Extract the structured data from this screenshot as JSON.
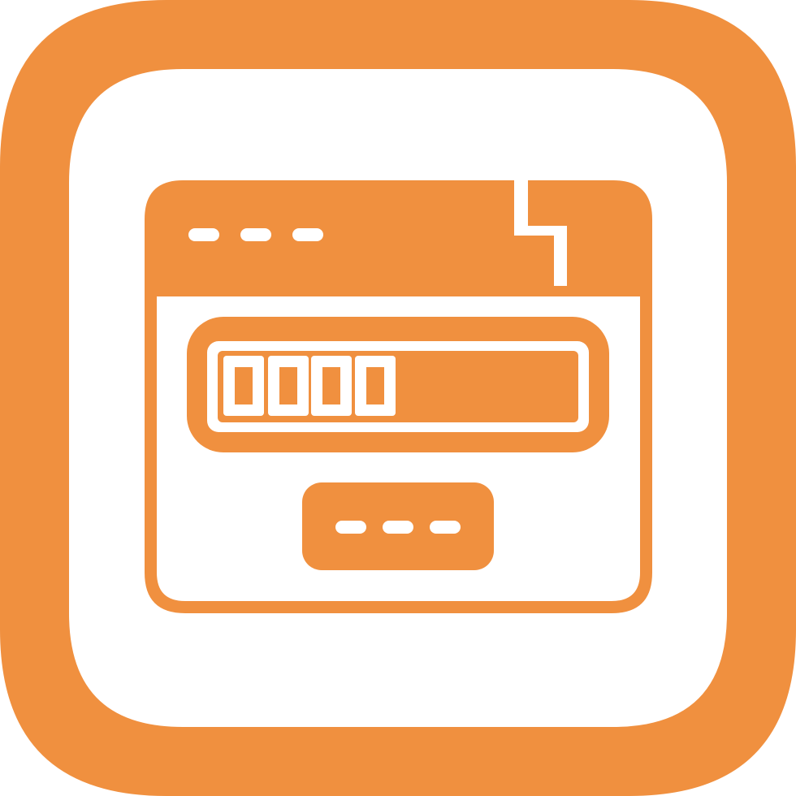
{
  "icon": {
    "name": "browser-password-icon",
    "frame": "rounded-square-outline",
    "colors": {
      "accent": "#F0903F",
      "background": "#FFFFFF"
    },
    "password_field": {
      "masked_digit_count": 4
    },
    "title_bar_dot_count": 3,
    "button_dot_count": 3
  }
}
